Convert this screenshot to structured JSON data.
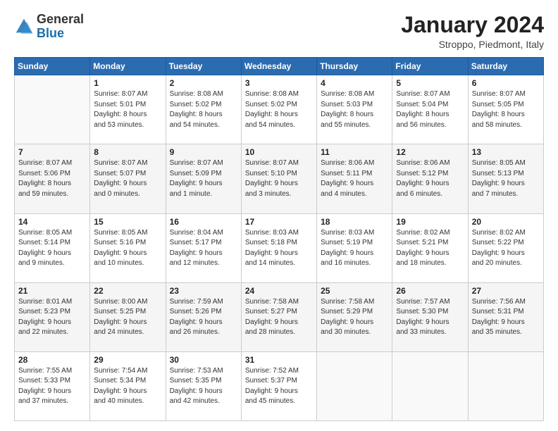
{
  "header": {
    "logo": {
      "general": "General",
      "blue": "Blue"
    },
    "title": "January 2024",
    "location": "Stroppo, Piedmont, Italy"
  },
  "weekdays": [
    "Sunday",
    "Monday",
    "Tuesday",
    "Wednesday",
    "Thursday",
    "Friday",
    "Saturday"
  ],
  "weeks": [
    [
      {
        "day": "",
        "info": ""
      },
      {
        "day": "1",
        "info": "Sunrise: 8:07 AM\nSunset: 5:01 PM\nDaylight: 8 hours\nand 53 minutes."
      },
      {
        "day": "2",
        "info": "Sunrise: 8:08 AM\nSunset: 5:02 PM\nDaylight: 8 hours\nand 54 minutes."
      },
      {
        "day": "3",
        "info": "Sunrise: 8:08 AM\nSunset: 5:02 PM\nDaylight: 8 hours\nand 54 minutes."
      },
      {
        "day": "4",
        "info": "Sunrise: 8:08 AM\nSunset: 5:03 PM\nDaylight: 8 hours\nand 55 minutes."
      },
      {
        "day": "5",
        "info": "Sunrise: 8:07 AM\nSunset: 5:04 PM\nDaylight: 8 hours\nand 56 minutes."
      },
      {
        "day": "6",
        "info": "Sunrise: 8:07 AM\nSunset: 5:05 PM\nDaylight: 8 hours\nand 58 minutes."
      }
    ],
    [
      {
        "day": "7",
        "info": "Sunrise: 8:07 AM\nSunset: 5:06 PM\nDaylight: 8 hours\nand 59 minutes."
      },
      {
        "day": "8",
        "info": "Sunrise: 8:07 AM\nSunset: 5:07 PM\nDaylight: 9 hours\nand 0 minutes."
      },
      {
        "day": "9",
        "info": "Sunrise: 8:07 AM\nSunset: 5:09 PM\nDaylight: 9 hours\nand 1 minute."
      },
      {
        "day": "10",
        "info": "Sunrise: 8:07 AM\nSunset: 5:10 PM\nDaylight: 9 hours\nand 3 minutes."
      },
      {
        "day": "11",
        "info": "Sunrise: 8:06 AM\nSunset: 5:11 PM\nDaylight: 9 hours\nand 4 minutes."
      },
      {
        "day": "12",
        "info": "Sunrise: 8:06 AM\nSunset: 5:12 PM\nDaylight: 9 hours\nand 6 minutes."
      },
      {
        "day": "13",
        "info": "Sunrise: 8:05 AM\nSunset: 5:13 PM\nDaylight: 9 hours\nand 7 minutes."
      }
    ],
    [
      {
        "day": "14",
        "info": "Sunrise: 8:05 AM\nSunset: 5:14 PM\nDaylight: 9 hours\nand 9 minutes."
      },
      {
        "day": "15",
        "info": "Sunrise: 8:05 AM\nSunset: 5:16 PM\nDaylight: 9 hours\nand 10 minutes."
      },
      {
        "day": "16",
        "info": "Sunrise: 8:04 AM\nSunset: 5:17 PM\nDaylight: 9 hours\nand 12 minutes."
      },
      {
        "day": "17",
        "info": "Sunrise: 8:03 AM\nSunset: 5:18 PM\nDaylight: 9 hours\nand 14 minutes."
      },
      {
        "day": "18",
        "info": "Sunrise: 8:03 AM\nSunset: 5:19 PM\nDaylight: 9 hours\nand 16 minutes."
      },
      {
        "day": "19",
        "info": "Sunrise: 8:02 AM\nSunset: 5:21 PM\nDaylight: 9 hours\nand 18 minutes."
      },
      {
        "day": "20",
        "info": "Sunrise: 8:02 AM\nSunset: 5:22 PM\nDaylight: 9 hours\nand 20 minutes."
      }
    ],
    [
      {
        "day": "21",
        "info": "Sunrise: 8:01 AM\nSunset: 5:23 PM\nDaylight: 9 hours\nand 22 minutes."
      },
      {
        "day": "22",
        "info": "Sunrise: 8:00 AM\nSunset: 5:25 PM\nDaylight: 9 hours\nand 24 minutes."
      },
      {
        "day": "23",
        "info": "Sunrise: 7:59 AM\nSunset: 5:26 PM\nDaylight: 9 hours\nand 26 minutes."
      },
      {
        "day": "24",
        "info": "Sunrise: 7:58 AM\nSunset: 5:27 PM\nDaylight: 9 hours\nand 28 minutes."
      },
      {
        "day": "25",
        "info": "Sunrise: 7:58 AM\nSunset: 5:29 PM\nDaylight: 9 hours\nand 30 minutes."
      },
      {
        "day": "26",
        "info": "Sunrise: 7:57 AM\nSunset: 5:30 PM\nDaylight: 9 hours\nand 33 minutes."
      },
      {
        "day": "27",
        "info": "Sunrise: 7:56 AM\nSunset: 5:31 PM\nDaylight: 9 hours\nand 35 minutes."
      }
    ],
    [
      {
        "day": "28",
        "info": "Sunrise: 7:55 AM\nSunset: 5:33 PM\nDaylight: 9 hours\nand 37 minutes."
      },
      {
        "day": "29",
        "info": "Sunrise: 7:54 AM\nSunset: 5:34 PM\nDaylight: 9 hours\nand 40 minutes."
      },
      {
        "day": "30",
        "info": "Sunrise: 7:53 AM\nSunset: 5:35 PM\nDaylight: 9 hours\nand 42 minutes."
      },
      {
        "day": "31",
        "info": "Sunrise: 7:52 AM\nSunset: 5:37 PM\nDaylight: 9 hours\nand 45 minutes."
      },
      {
        "day": "",
        "info": ""
      },
      {
        "day": "",
        "info": ""
      },
      {
        "day": "",
        "info": ""
      }
    ]
  ]
}
